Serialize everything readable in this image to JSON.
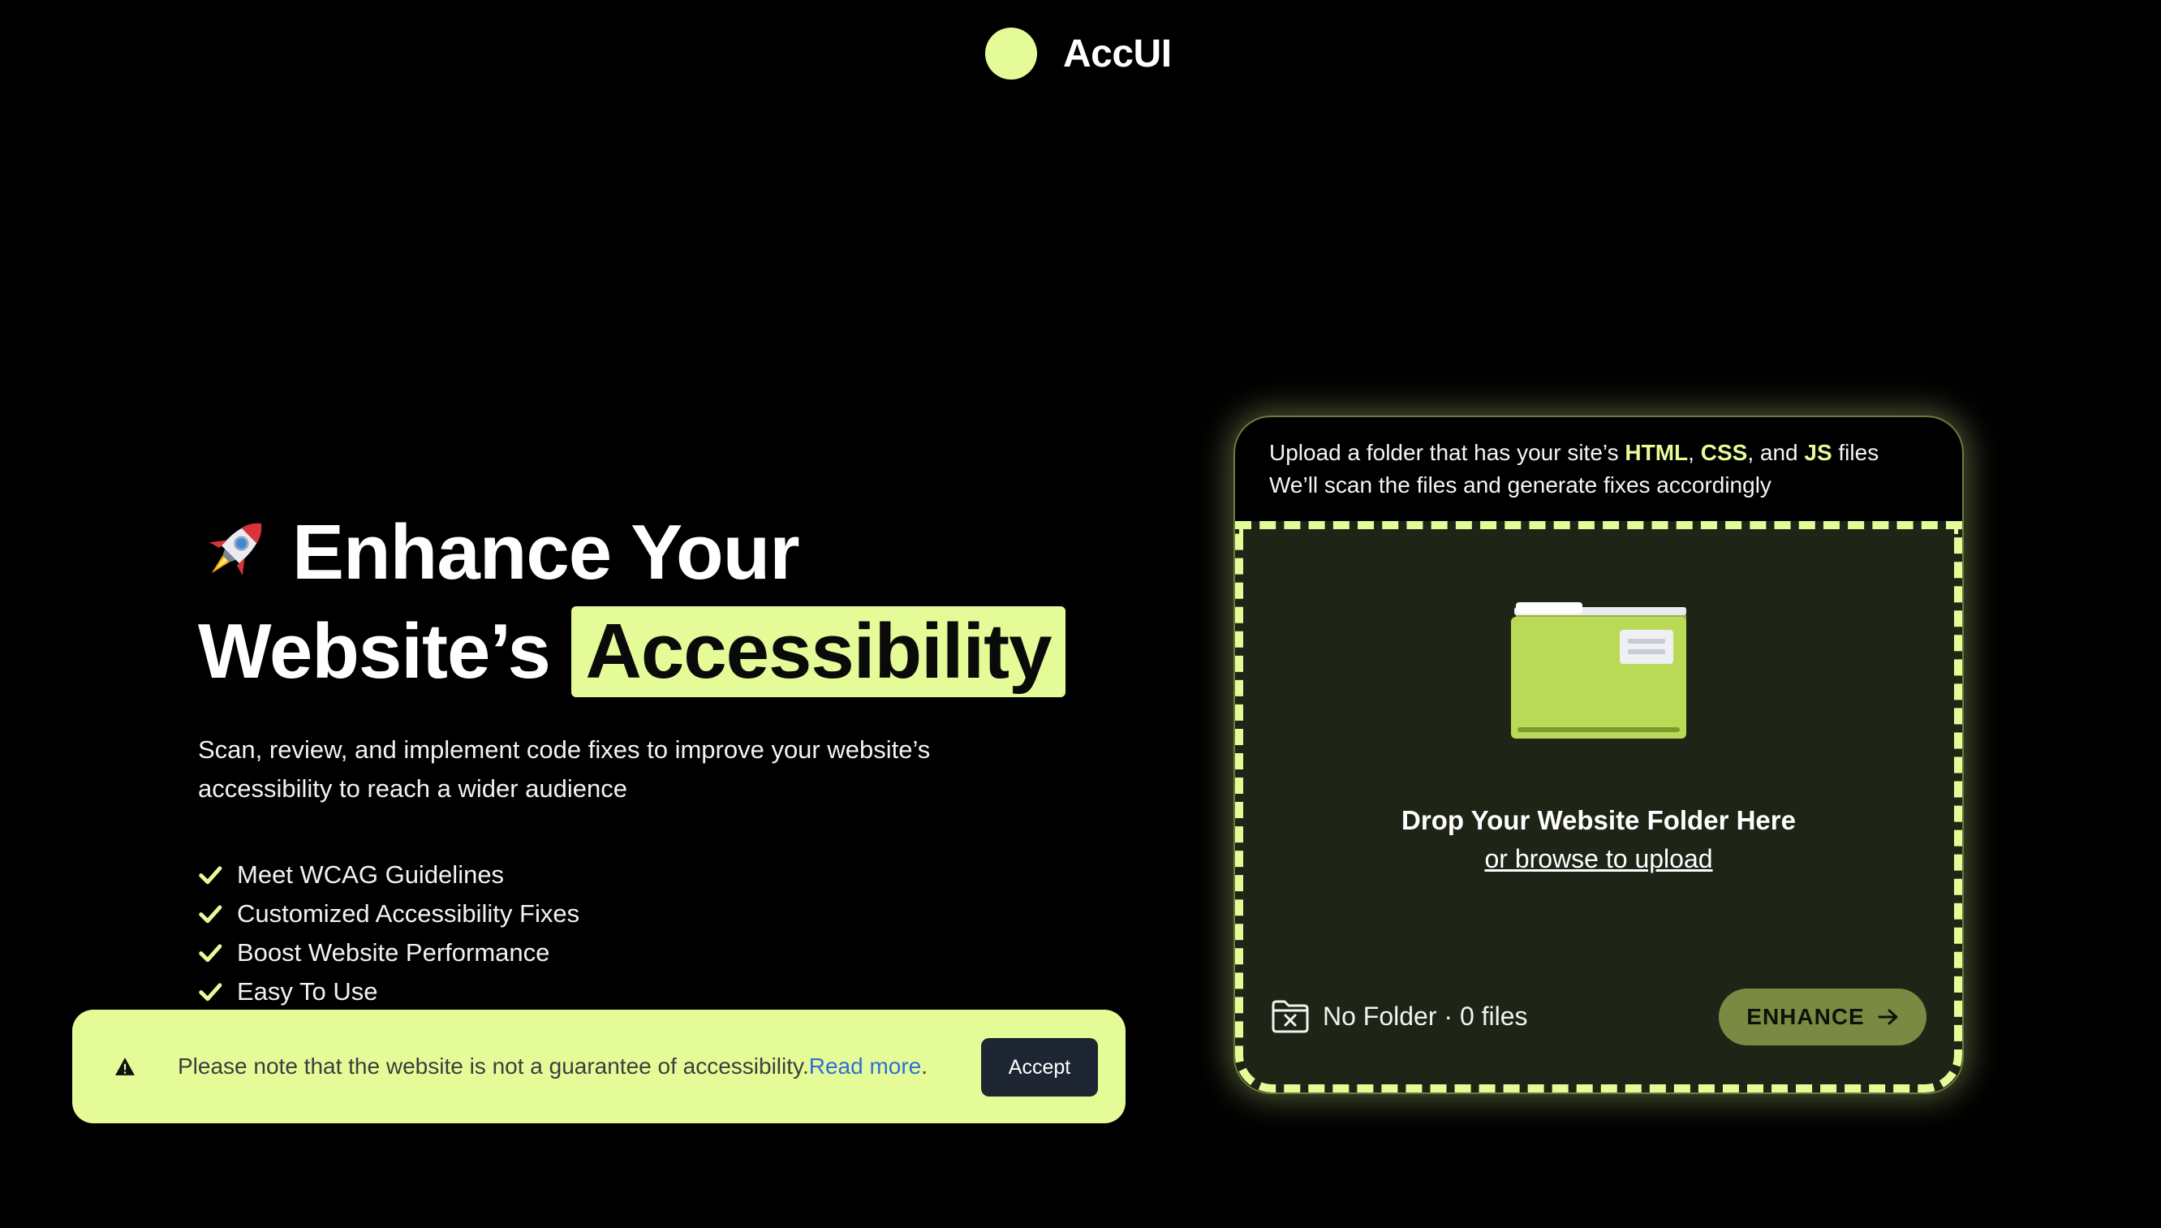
{
  "header": {
    "brand": "AccUI"
  },
  "hero": {
    "title_line1": "Enhance Your",
    "title_line2_prefix": "Website’s",
    "title_highlight": "Accessibility",
    "subtitle": "Scan, review, and implement code fixes to improve your website’s accessibility to reach a wider audience",
    "features": [
      "Meet WCAG Guidelines",
      "Customized Accessibility Fixes",
      "Boost Website Performance",
      "Easy To Use"
    ]
  },
  "notice": {
    "text": "Please note that the website is not a guarantee of accessibility.",
    "link": "Read more",
    "suffix": ".",
    "accept": "Accept"
  },
  "upload": {
    "intro_prefix": "Upload a folder that has your site’s ",
    "kw_html": "HTML",
    "sep1": ", ",
    "kw_css": "CSS",
    "sep2": ", and ",
    "kw_js": "JS",
    "intro_suffix": " files",
    "intro_line2": "We’ll scan the files and generate fixes accordingly",
    "drop_title": "Drop Your Website Folder Here",
    "browse": "or browse to upload",
    "status": "No Folder · 0 files",
    "enhance": "ENHANCE"
  },
  "colors": {
    "accent": "#e5fb98",
    "background": "#000000",
    "dropzone_bg": "#1f2516",
    "enhance_bg": "#7a8a42",
    "accept_bg": "#1f2633",
    "link": "#2f6fd6"
  },
  "icons": [
    "logo-dot",
    "rocket-icon",
    "check-icon",
    "warning-icon",
    "folder-icon",
    "folder-x-icon",
    "arrow-right-icon"
  ]
}
